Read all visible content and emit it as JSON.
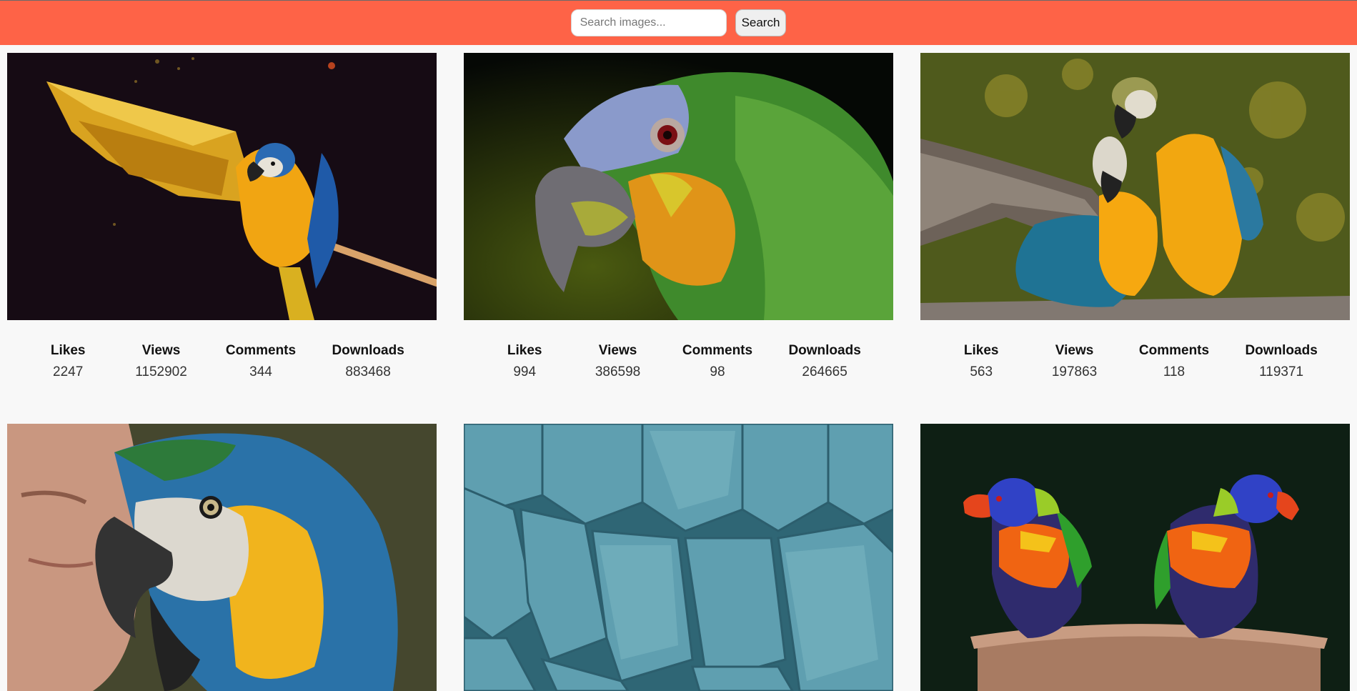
{
  "search": {
    "placeholder": "Search images...",
    "button_label": "Search"
  },
  "cards": [
    {
      "photo_icon": "macaw-wings-spread-photo",
      "stats": [
        {
          "label": "Likes",
          "value": "2247"
        },
        {
          "label": "Views",
          "value": "1152902"
        },
        {
          "label": "Comments",
          "value": "344"
        },
        {
          "label": "Downloads",
          "value": "883468"
        }
      ]
    },
    {
      "photo_icon": "green-amazon-parrot-photo",
      "stats": [
        {
          "label": "Likes",
          "value": "994"
        },
        {
          "label": "Views",
          "value": "386598"
        },
        {
          "label": "Comments",
          "value": "98"
        },
        {
          "label": "Downloads",
          "value": "264665"
        }
      ]
    },
    {
      "photo_icon": "two-macaws-photo",
      "stats": [
        {
          "label": "Likes",
          "value": "563"
        },
        {
          "label": "Views",
          "value": "197863"
        },
        {
          "label": "Comments",
          "value": "118"
        },
        {
          "label": "Downloads",
          "value": "119371"
        }
      ]
    },
    {
      "photo_icon": "macaw-closeup-photo",
      "stats": []
    },
    {
      "photo_icon": "blue-feathers-photo",
      "stats": []
    },
    {
      "photo_icon": "rainbow-lorikeets-photo",
      "stats": []
    }
  ]
}
